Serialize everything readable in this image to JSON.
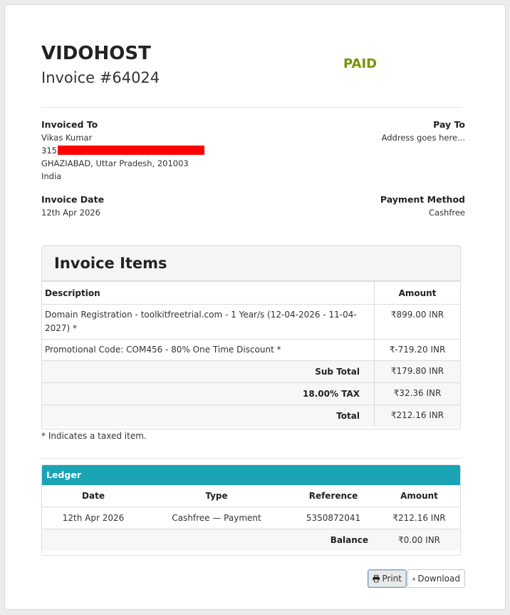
{
  "header": {
    "company": "VIDOHOST",
    "invoice_number": "Invoice #64024",
    "status": "PAID"
  },
  "invoiced_to": {
    "label": "Invoiced To",
    "name": "Vikas Kumar",
    "address_prefix": "315",
    "city_line": "GHAZIABAD, Uttar Pradesh, 201003",
    "country": "India"
  },
  "pay_to": {
    "label": "Pay To",
    "address": "Address goes here..."
  },
  "invoice_date": {
    "label": "Invoice Date",
    "value": "12th Apr 2026"
  },
  "payment_method": {
    "label": "Payment Method",
    "value": "Cashfree"
  },
  "items": {
    "title": "Invoice Items",
    "col_description": "Description",
    "col_amount": "Amount",
    "rows": [
      {
        "description": "Domain Registration - toolkitfreetrial.com - 1 Year/s (12-04-2026 - 11-04-2027) *",
        "amount": "₹899.00 INR"
      },
      {
        "description": "Promotional Code: COM456 - 80% One Time Discount *",
        "amount": "₹-719.20 INR"
      }
    ],
    "subtotal_label": "Sub Total",
    "subtotal": "₹179.80 INR",
    "tax_label": "18.00% TAX",
    "tax": "₹32.36 INR",
    "total_label": "Total",
    "total": "₹212.16 INR"
  },
  "taxed_note": "* Indicates a taxed item.",
  "ledger": {
    "title": "Ledger",
    "col_date": "Date",
    "col_type": "Type",
    "col_reference": "Reference",
    "col_amount": "Amount",
    "row": {
      "date": "12th Apr 2026",
      "type": "Cashfree — Payment",
      "reference": "5350872041",
      "amount": "₹212.16 INR"
    },
    "balance_label": "Balance",
    "balance": "₹0.00 INR"
  },
  "actions": {
    "print_label": "Print",
    "download_label": "Download"
  },
  "colors": {
    "status_paid": "#779500",
    "ledger_header": "#1ba3b6",
    "redaction": "#ff0000"
  },
  "icons": {
    "print": "printer-icon",
    "download": "download-icon"
  }
}
